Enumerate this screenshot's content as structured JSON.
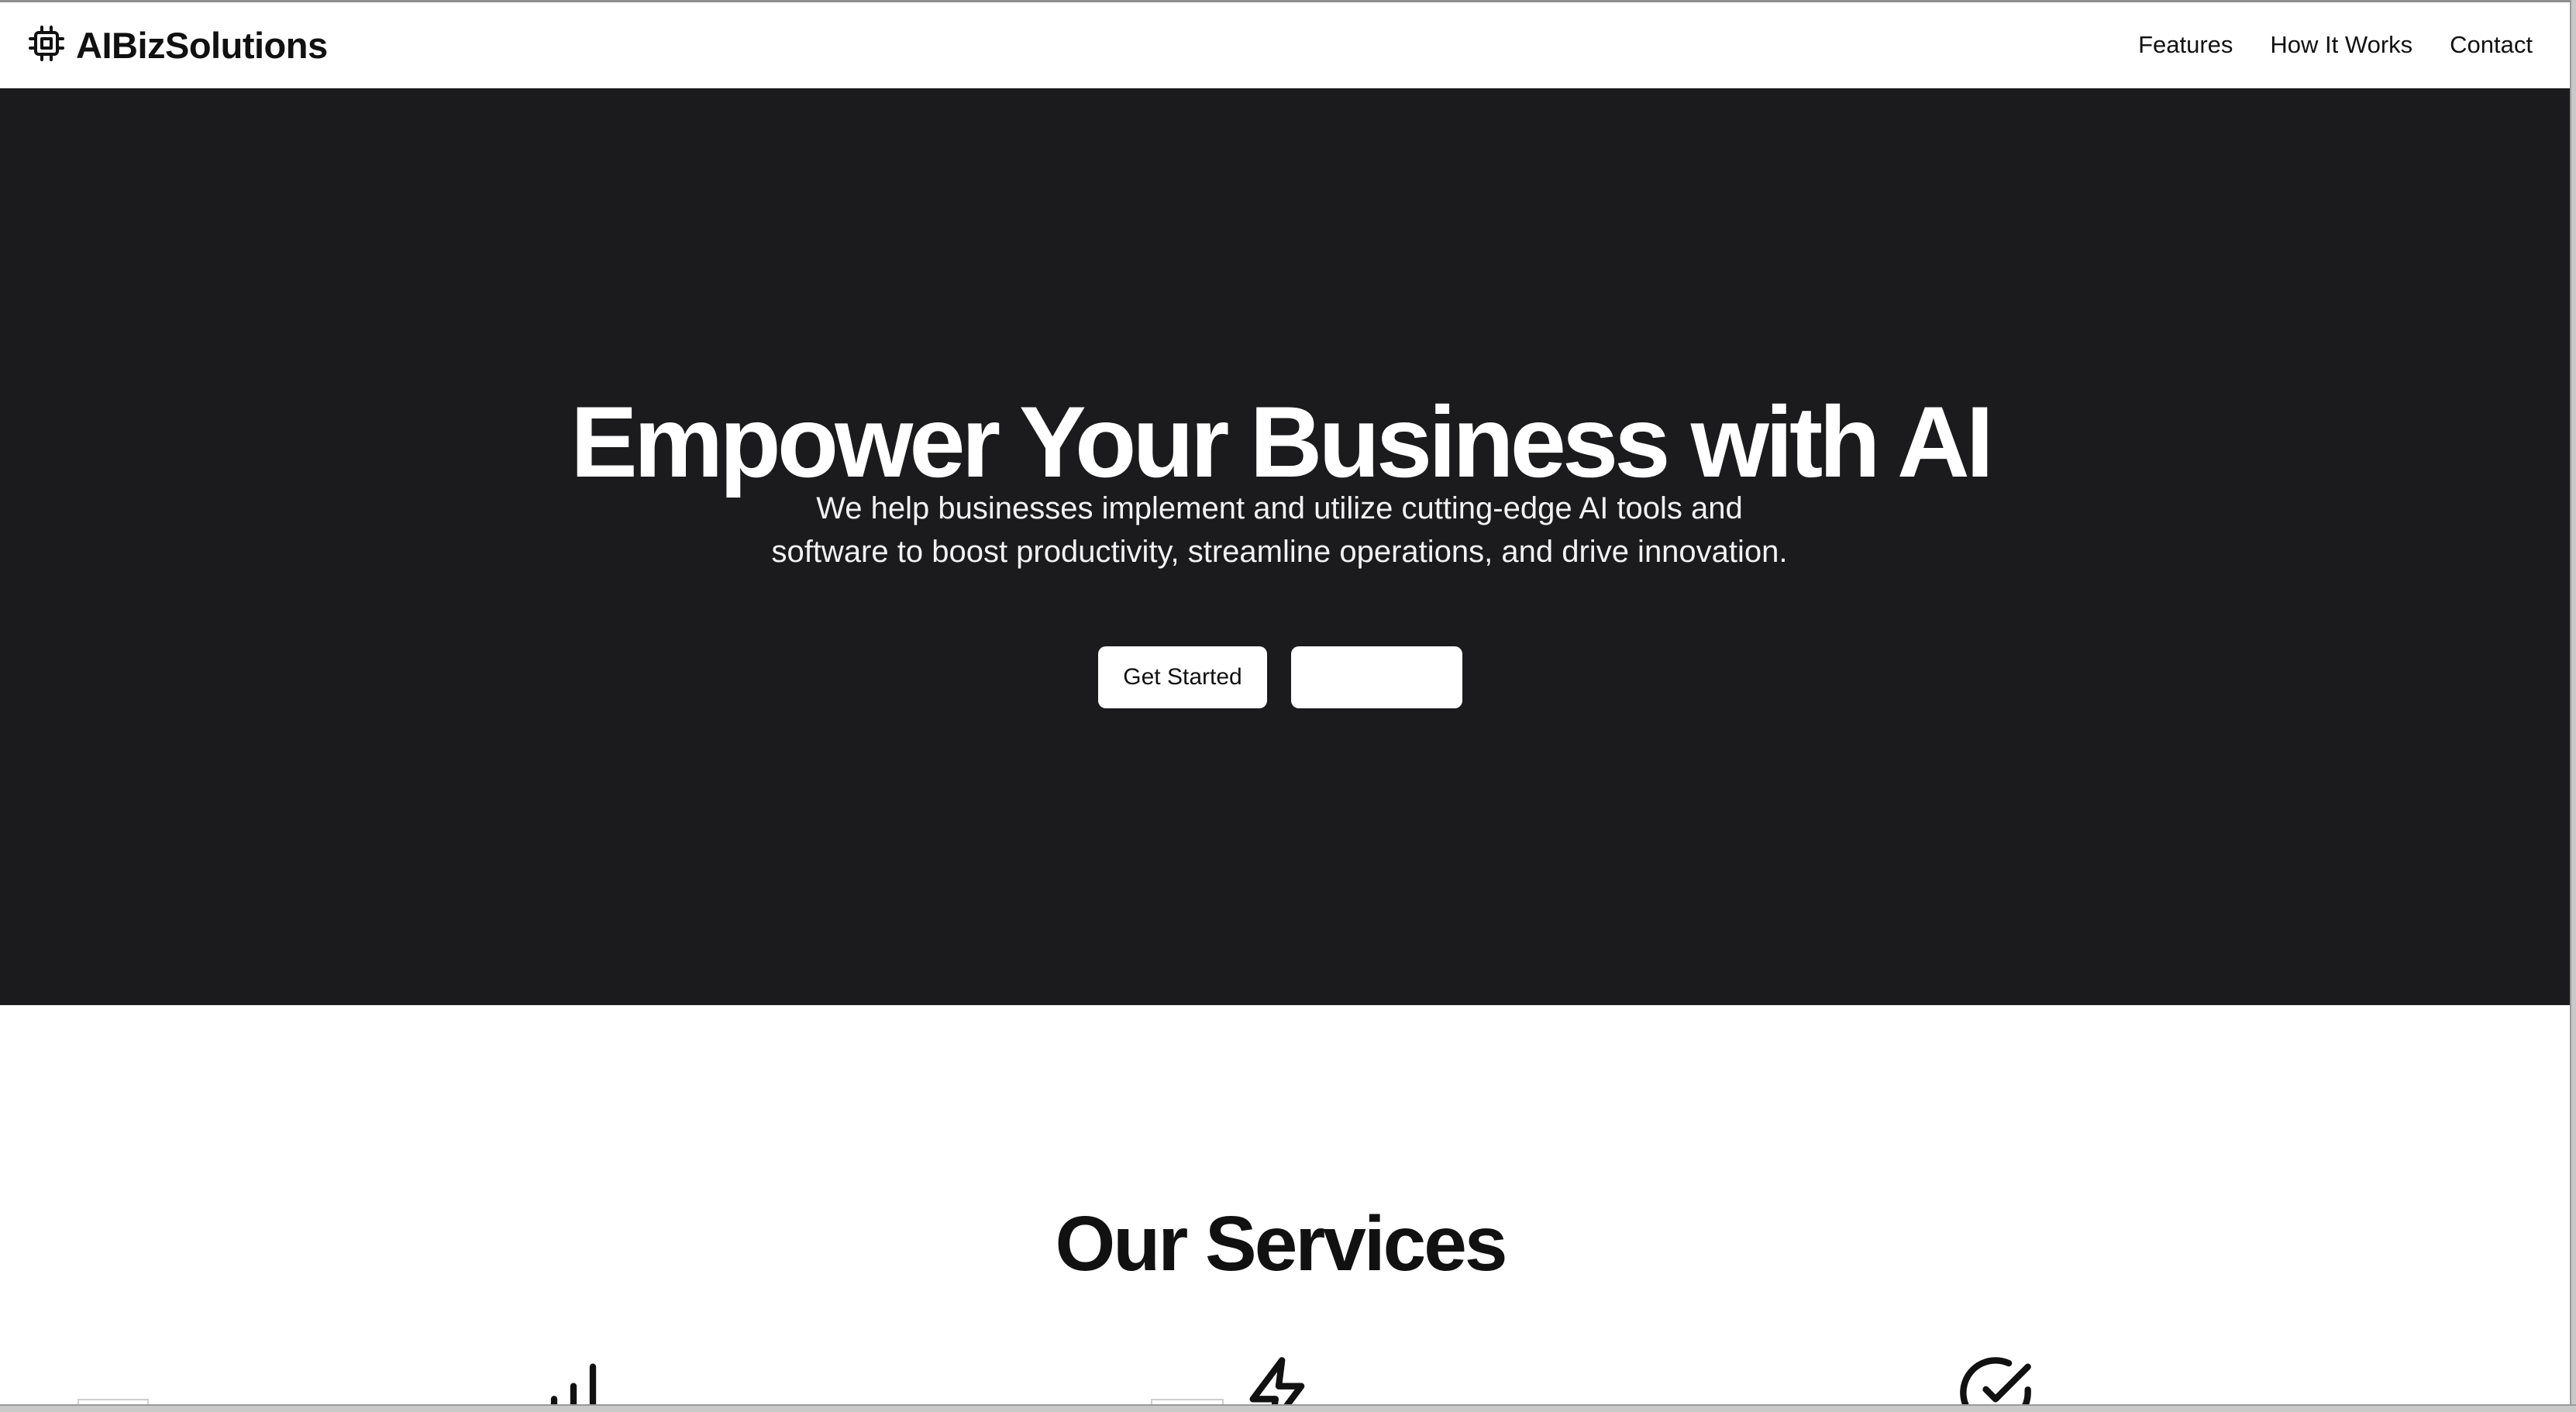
{
  "header": {
    "brand_name": "AIBizSolutions",
    "nav": [
      {
        "label": "Features"
      },
      {
        "label": "How It Works"
      },
      {
        "label": "Contact"
      }
    ]
  },
  "hero": {
    "title": "Empower Your Business with AI",
    "subtitle": "We help businesses implement and utilize cutting-edge AI tools and software to boost productivity, streamline operations, and drive innovation.",
    "primary_button": "Get Started",
    "secondary_button": ""
  },
  "services": {
    "title": "Our Services",
    "icons": [
      "bar-chart-icon",
      "lightning-bolt-icon",
      "check-circle-icon"
    ]
  },
  "colors": {
    "hero_background": "#1b1b1d",
    "text_dark": "#111111",
    "white": "#ffffff"
  }
}
